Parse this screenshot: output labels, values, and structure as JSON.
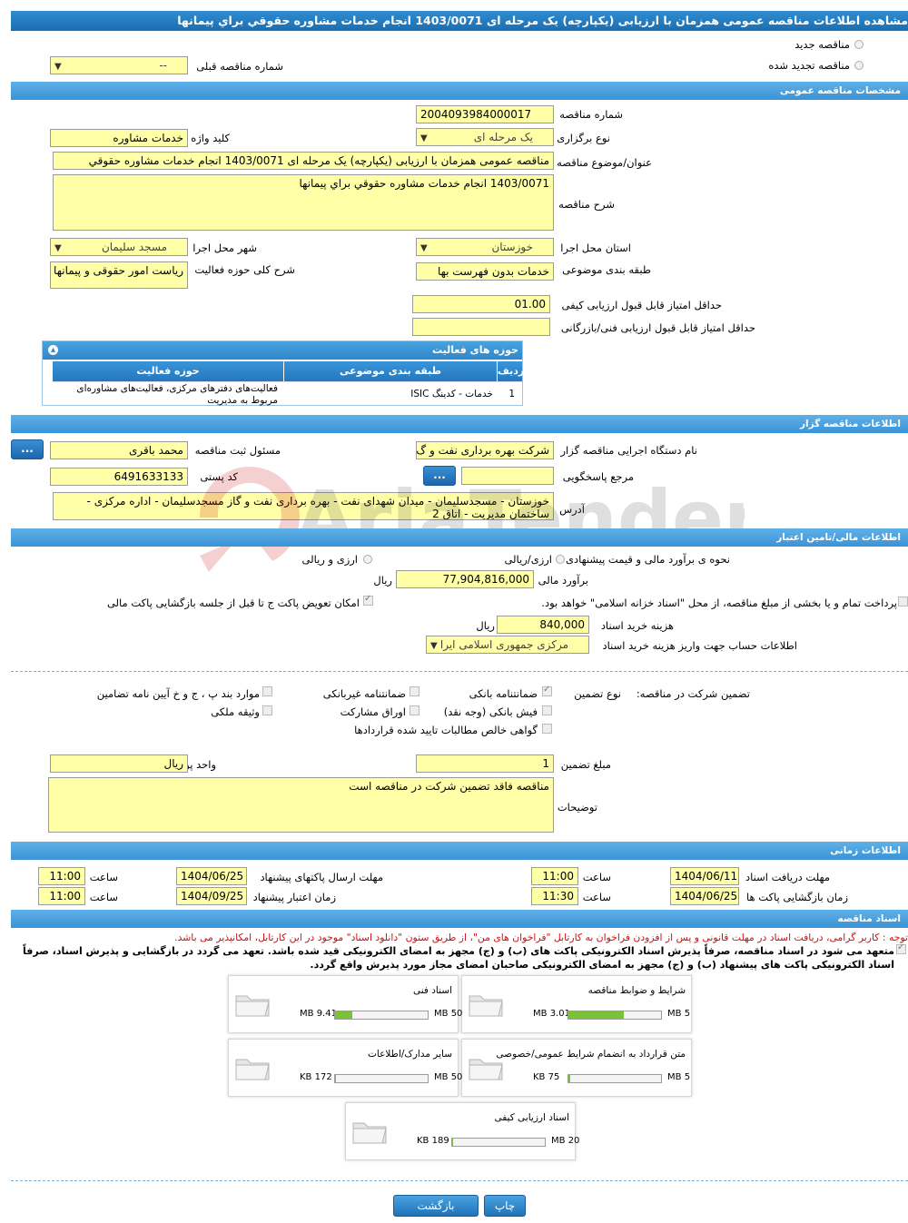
{
  "title": "مشاهده اطلاعات مناقصه عمومی همزمان با ارزیابی (یکپارچه) یک مرحله ای 1403/0071 انجام خدمات مشاوره حقوقي براي پيمانها",
  "top": {
    "new_tender": "مناقصه جدید",
    "renewed_tender": "مناقصه تجدید شده",
    "prev_tender_label": "شماره مناقصه قبلی",
    "prev_tender_value": "--"
  },
  "general": {
    "header": "مشخصات مناقصه عمومی",
    "tender_no_label": "شماره مناقصه",
    "tender_no": "2004093984000017",
    "type_label": "نوع برگزاری",
    "type_value": "یک مرحله ای",
    "keyword_label": "کلید واژه",
    "keyword_value": "خدمات مشاوره",
    "subject_label": "عنوان/موضوع مناقصه",
    "subject_value": "مناقصه عمومی همزمان با ارزیابی (یکپارچه) یک مرحله ای 1403/0071 انجام خدمات مشاوره حقوقي",
    "desc_label": "شرح مناقصه",
    "desc_value": "1403/0071 انجام خدمات مشاوره حقوقي براي پيمانها",
    "province_label": "استان محل اجرا",
    "province_value": "خوزستان",
    "city_label": "شهر محل اجرا",
    "city_value": "مسجد سليمان",
    "category_label": "طبقه بندی موضوعی",
    "category_value": "خدمات بدون فهرست بها",
    "activity_label": "شرح کلی حوزه فعالیت",
    "activity_value": "ریاست امور حقوقی و پیمانها",
    "min_quality_label": "حداقل امتیاز قابل قبول ارزیابی کیفی",
    "min_quality_value": "01.00",
    "min_tech_label": "حداقل امتیاز قابل قبول ارزیابی فنی/بازرگانی",
    "min_tech_value": ""
  },
  "activity_table": {
    "header": "حوزه های فعالیت",
    "columns": [
      "ردیف",
      "طبقه بندی موضوعی",
      "حوزه فعالیت"
    ],
    "rows": [
      {
        "idx": "1",
        "category": "خدمات - کدینگ ISIC",
        "field": "فعالیت‌های دفترهای مرکزی، فعالیت‌های مشاوره‌ای مربوط به مدیریت"
      }
    ]
  },
  "organizer": {
    "header": "اطلاعات مناقصه گزار",
    "org_label": "نام دستگاه اجرایی مناقصه گزار",
    "org_value": "شرکت بهره برداری نفت و گ",
    "registrar_label": "مسئول ثبت مناقصه",
    "registrar_value": "محمد باقری",
    "ref_label": "مرجع پاسخگویی",
    "ref_value": "",
    "postal_label": "کد پستی",
    "postal_value": "6491633133",
    "address_label": "آدرس",
    "address_value": "خوزستان - مسجدسلیمان - میدان شهدای نفت - بهره برداری نفت و گاز مسجدسلیمان - اداره مرکزی - ساختمان مدیریت - اتاق 2",
    "dots": "..."
  },
  "finance": {
    "header": "اطلاعات مالی/تامین اعتبار",
    "estimate_method_label": "نحوه ی برآورد مالی و قیمت پیشنهادی",
    "opt_rial_fx": "ارزی/ریالی",
    "opt_fx_and_rial": "ارزی و ریالی",
    "estimate_label": "برآورد مالی",
    "estimate_value": "77,904,816,000",
    "rial": "ریال",
    "treasury_text": "پرداخت تمام و یا بخشی از مبلغ مناقصه، از محل \"اسناد خزانه اسلامی\" خواهد بود.",
    "swap_text": "امکان تعویض پاکت ج تا قبل از جلسه بازگشایی پاکت مالی",
    "doc_fee_label": "هزینه خرید اسناد",
    "doc_fee_value": "840,000",
    "account_label": "اطلاعات حساب جهت واریز هزینه خرید اسناد",
    "account_value": "مرکزی جمهوری اسلامی ایرا"
  },
  "guarantee": {
    "label": "تضمین شرکت در مناقصه:",
    "type_label": "نوع تضمین",
    "opt_bank_guarantee": "ضمانتنامه بانکی",
    "opt_nonbank_guarantee": "ضمانتنامه غیربانکی",
    "opt_regulation": "موارد بند پ ، ج و خ آیین نامه تضامین",
    "opt_cash": "فیش بانکی (وجه نقد)",
    "opt_bonds": "اوراق مشارکت",
    "opt_property": "وثیقه ملکی",
    "opt_claims": "گواهی خالص مطالبات تایید شده قراردادها",
    "amount_label": "مبلغ تضمین",
    "amount_value": "1",
    "currency_label": "واحد پول",
    "currency_value": "ريال",
    "notes_label": "توضیحات",
    "notes_value": "مناقصه فاقد تضمین شرکت در مناقصه است"
  },
  "timing": {
    "header": "اطلاعات زمانی",
    "receive_label": "مهلت دریافت اسناد",
    "receive_date": "1404/06/11",
    "receive_time": "11:00",
    "submit_label": "مهلت ارسال پاکتهای پیشنهاد",
    "submit_date": "1404/06/25",
    "submit_time": "11:00",
    "open_label": "زمان بازگشایی پاکت ها",
    "open_date": "1404/06/25",
    "open_time": "11:30",
    "valid_label": "زمان اعتبار پیشنهاد",
    "valid_date": "1404/09/25",
    "valid_time": "11:00",
    "time_label": "ساعت"
  },
  "documents": {
    "header": "اسناد مناقصه",
    "notice": "توجه : کاربر گرامی، دریافت اسناد در مهلت قانونی و پس از افزودن فراخوان به کارتابل \"فراخوان های من\"، از طریق ستون \"دانلود اسناد\" موجود در این کارتابل، امکانپذیر می باشد.",
    "commitment": "متعهد می شود در اسناد مناقصه، صرفاً پذیرش اسناد الکترونیکی پاکت های (ب) و (ج) مجهز به امضای الکترونیکی قید شده باشد. تعهد می گردد در بازگشایی و پذیرش اسناد، صرفاً اسناد الکترونیکی پاکت های پیشنهاد (ب) و (ج) مجهز به امضای الکترونیکی صاحبان امضای مجاز مورد پذیرش واقع گردد.",
    "cards": [
      {
        "name": "شرایط و ضوابط مناقصه",
        "size": "3.01 MB",
        "max": "5 MB",
        "fill": 0.6
      },
      {
        "name": "اسناد فنی",
        "size": "9.41 MB",
        "max": "50 MB",
        "fill": 0.19
      },
      {
        "name": "متن قرارداد به انضمام شرایط عمومی/خصوصی",
        "size": "75 KB",
        "max": "5 MB",
        "fill": 0.015
      },
      {
        "name": "سایر مدارک/اطلاعات",
        "size": "172 KB",
        "max": "50 MB",
        "fill": 0.004
      },
      {
        "name": "اسناد ارزیابی کیفی",
        "size": "189 KB",
        "max": "20 MB",
        "fill": 0.01
      }
    ]
  },
  "buttons": {
    "print": "چاپ",
    "back": "بازگشت"
  },
  "colors": {
    "accent": "#2f8dcf",
    "field": "#ffffa8",
    "progress": "#7bc23a",
    "notice": "#d01010"
  }
}
